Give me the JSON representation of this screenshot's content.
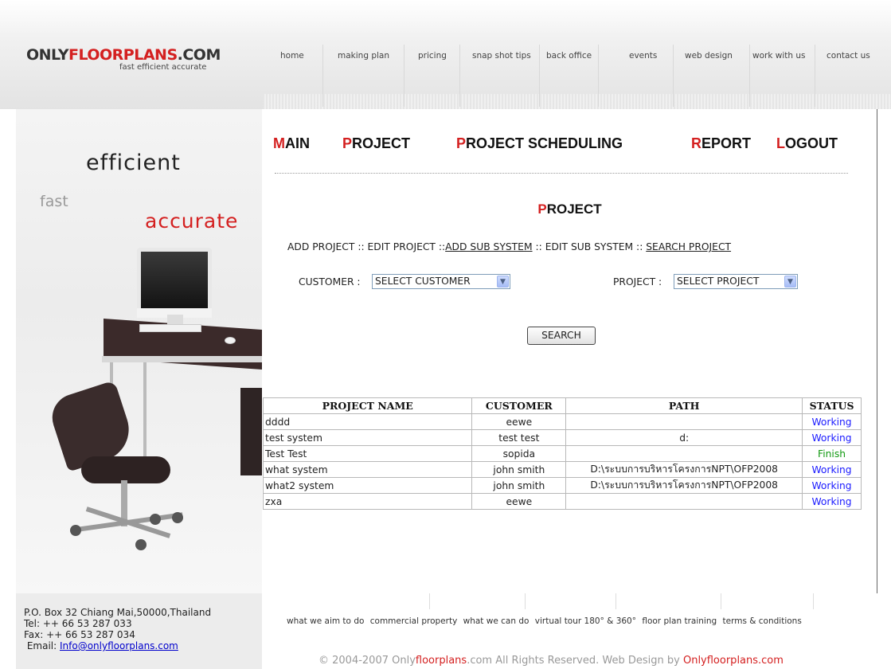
{
  "header": {
    "logo": {
      "part1": "ONLY",
      "part2": "FLOORPLANS",
      "part3": ".COM"
    },
    "tagline": "fast efficient accurate",
    "topnav": [
      "home",
      "making plan",
      "pricing",
      "snap shot tips",
      "back office",
      "events",
      "web design",
      "work with us",
      "contact us"
    ]
  },
  "left": {
    "word_efficient": "efficient",
    "word_fast": "fast",
    "word_accurate": "accurate",
    "address_line1": "P.O. Box 32 Chiang Mai,50000,Thailand",
    "address_line2": "Tel: ++ 66 53 287 033",
    "address_line3": "Fax: ++ 66 53 287 034",
    "email_label": "Email:",
    "email": "Info@onlyfloorplans.com"
  },
  "menu": [
    {
      "first": "M",
      "rest": "AIN"
    },
    {
      "first": "P",
      "rest": "ROJECT"
    },
    {
      "first": "P",
      "rest": "ROJECT SCHEDULING"
    },
    {
      "first": "R",
      "rest": "EPORT"
    },
    {
      "first": "L",
      "rest": "OGOUT"
    }
  ],
  "page_title": {
    "first": "P",
    "rest": "ROJECT"
  },
  "subnav": {
    "add_project": "ADD PROJECT",
    "sep1": " :: ",
    "edit_project": "EDIT PROJECT",
    "sep2": " ::",
    "add_sub_system": "ADD SUB SYSTEM",
    "sep3": " :: ",
    "edit_sub_system": "EDIT SUB SYSTEM",
    "sep4": " :: ",
    "search_project": "SEARCH PROJECT"
  },
  "filters": {
    "customer_label": "CUSTOMER :",
    "customer_value": "SELECT CUSTOMER",
    "project_label": "PROJECT :",
    "project_value": "SELECT PROJECT"
  },
  "search_button": "SEARCH",
  "table": {
    "columns": [
      "PROJECT NAME",
      "CUSTOMER",
      "PATH",
      "STATUS"
    ],
    "rows": [
      [
        "dddd",
        "eewe",
        "",
        "Working"
      ],
      [
        "test system",
        "test test",
        "d:",
        "Working"
      ],
      [
        "Test Test",
        "sopida",
        "",
        "Finish"
      ],
      [
        "what system",
        "john smith",
        "D:\\ระบบการบริหารโครงการNPT\\OFP2008",
        "Working"
      ],
      [
        "what2 system",
        "john smith",
        "D:\\ระบบการบริหารโครงการNPT\\OFP2008",
        "Working"
      ],
      [
        "zxa",
        "eewe",
        "",
        "Working"
      ]
    ]
  },
  "footer": {
    "links": [
      "what we aim to do",
      "commercial property",
      "what we can do",
      "virtual tour 180° & 360°",
      "floor plan training",
      "terms & conditions"
    ],
    "copyright_prefix": "© 2004-2007 Only",
    "copyright_red1": "floorplans",
    "copyright_mid": ".com All Rights Reserved. Web Design by ",
    "copyright_red2": "Onlyfloorplans.com"
  },
  "colors": {
    "accent_red": "#d42020",
    "status_working": "#1a1aff",
    "status_finish": "#119911",
    "link_blue": "#0000cc"
  }
}
